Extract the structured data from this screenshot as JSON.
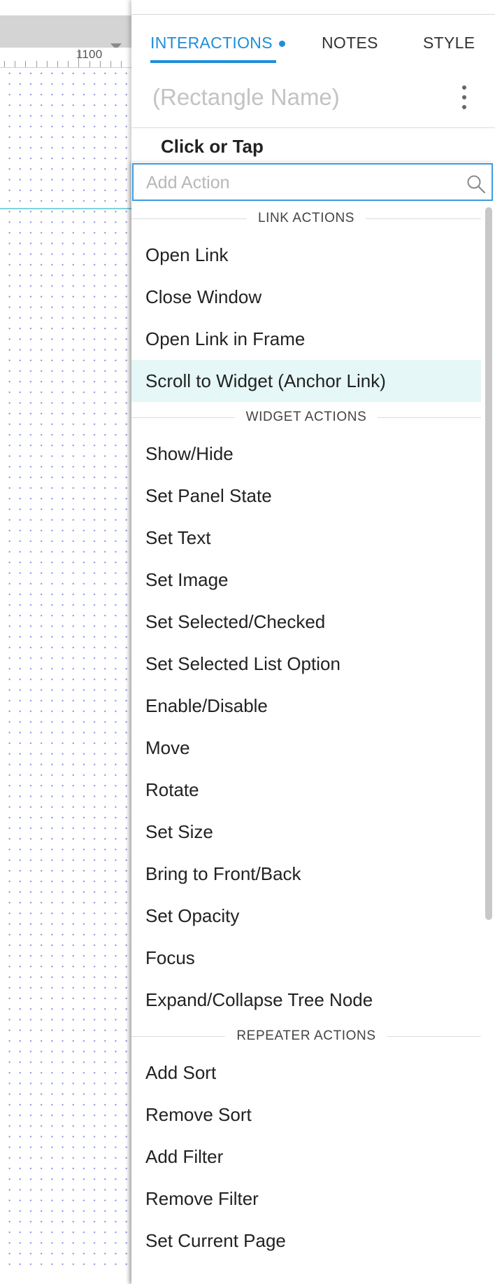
{
  "canvas": {
    "ruler_label": "1100",
    "dot_color": "#7b86e6",
    "guide_color": "#7fd3dc"
  },
  "panel": {
    "tabs": [
      {
        "label": "INTERACTIONS",
        "active": true,
        "has_indicator_dot": true
      },
      {
        "label": "NOTES",
        "active": false
      },
      {
        "label": "STYLE",
        "active": false
      }
    ],
    "accent_color": "#1f8ed8",
    "widget_name_placeholder": "(Rectangle Name)",
    "more_menu_icon": "vertical-ellipsis-icon",
    "event_title": "Click or Tap"
  },
  "dropdown": {
    "search": {
      "placeholder": "Add Action",
      "value": "",
      "icon": "search-icon"
    },
    "highlight_color": "#e5f7f6",
    "groups": [
      {
        "header": "LINK ACTIONS",
        "items": [
          "Open Link",
          "Close Window",
          "Open Link in Frame",
          "Scroll to Widget (Anchor Link)"
        ]
      },
      {
        "header": "WIDGET ACTIONS",
        "items": [
          "Show/Hide",
          "Set Panel State",
          "Set Text",
          "Set Image",
          "Set Selected/Checked",
          "Set Selected List Option",
          "Enable/Disable",
          "Move",
          "Rotate",
          "Set Size",
          "Bring to Front/Back",
          "Set Opacity",
          "Focus",
          "Expand/Collapse Tree Node"
        ]
      },
      {
        "header": "REPEATER ACTIONS",
        "items": [
          "Add Sort",
          "Remove Sort",
          "Add Filter",
          "Remove Filter",
          "Set Current Page"
        ]
      }
    ],
    "highlighted_item": "Scroll to Widget (Anchor Link)"
  }
}
